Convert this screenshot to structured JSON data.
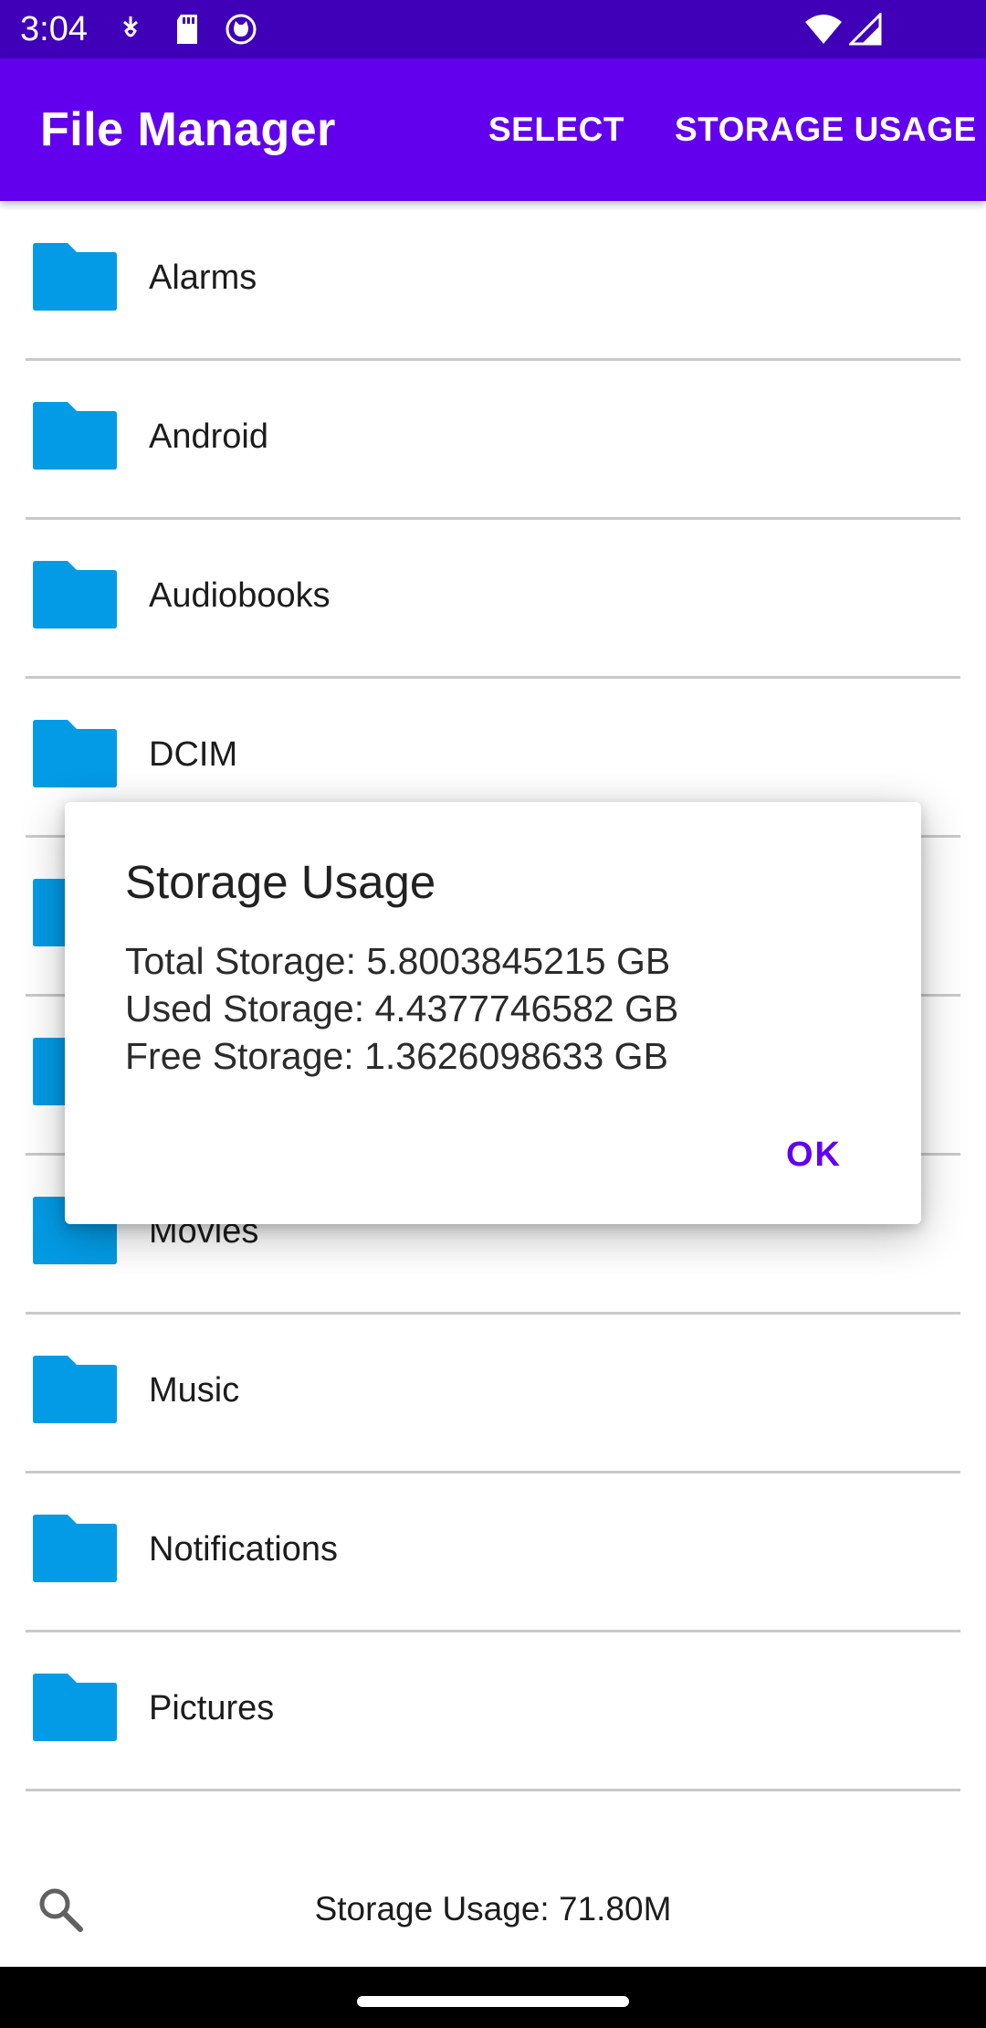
{
  "status_bar": {
    "time": "3:04",
    "icons": [
      "notification-icon",
      "sd-card-icon",
      "cat-face-icon",
      "wifi-icon",
      "signal-icon"
    ]
  },
  "app_bar": {
    "title": "File Manager",
    "actions": {
      "select_label": "SELECT",
      "storage_usage_label": "STORAGE USAGE"
    },
    "color": "#6200ee"
  },
  "folders": [
    {
      "name": "Alarms"
    },
    {
      "name": "Android"
    },
    {
      "name": "Audiobooks"
    },
    {
      "name": "DCIM"
    },
    {
      "name": ""
    },
    {
      "name": ""
    },
    {
      "name": "Movies"
    },
    {
      "name": "Music"
    },
    {
      "name": "Notifications"
    },
    {
      "name": "Pictures"
    }
  ],
  "folder_icon_color": "#039be5",
  "bottom_bar": {
    "search_icon": "search-icon",
    "storage_usage_text": "Storage Usage: 71.80M"
  },
  "dialog": {
    "title": "Storage Usage",
    "total_storage": "Total Storage: 5.8003845215 GB",
    "used_storage": "Used Storage: 4.4377746582 GB",
    "free_storage": "Free Storage: 1.3626098633 GB",
    "ok_label": "OK"
  }
}
